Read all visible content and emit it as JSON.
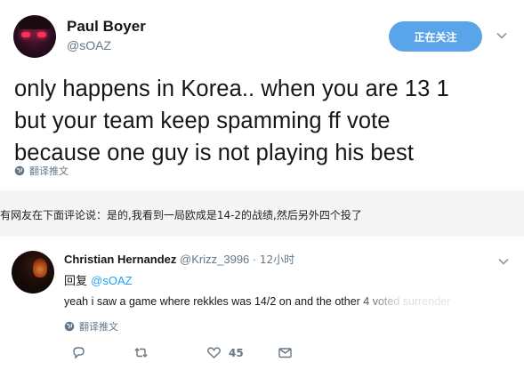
{
  "tweet": {
    "display_name": "Paul Boyer",
    "handle": "@sOAZ",
    "follow_label": "正在关注",
    "lines": [
      "only happens in Korea.. when you are 13 1",
      "but your team keep spamming ff vote",
      "because one guy is not playing his best"
    ],
    "translate_label": "翻译推文"
  },
  "caption": {
    "text": "有网友在下面评论说：是的,我看到一局欧成是14-2的战绩,然后另外四个投了"
  },
  "reply": {
    "display_name": "Christian Hernandez",
    "handle": "@Krizz_3996",
    "separator": "·",
    "time": "12小时",
    "replying_prefix": "回复",
    "replying_mention": "@sOAZ",
    "text": "yeah i saw a game where rekkles was 14/2 on and the other 4 voted surrender",
    "translate_label": "翻译推文",
    "like_count": "45"
  },
  "icons": {
    "follow_chevron": "chevron-down-icon",
    "globe": "globe-icon",
    "reply": "reply-icon",
    "retweet": "retweet-icon",
    "like": "heart-icon",
    "dm": "mail-icon"
  },
  "colors": {
    "follow_button": "#5aa5e9",
    "mention": "#1da1f2",
    "muted": "#657786",
    "caption_band": "#f5f5f5"
  }
}
